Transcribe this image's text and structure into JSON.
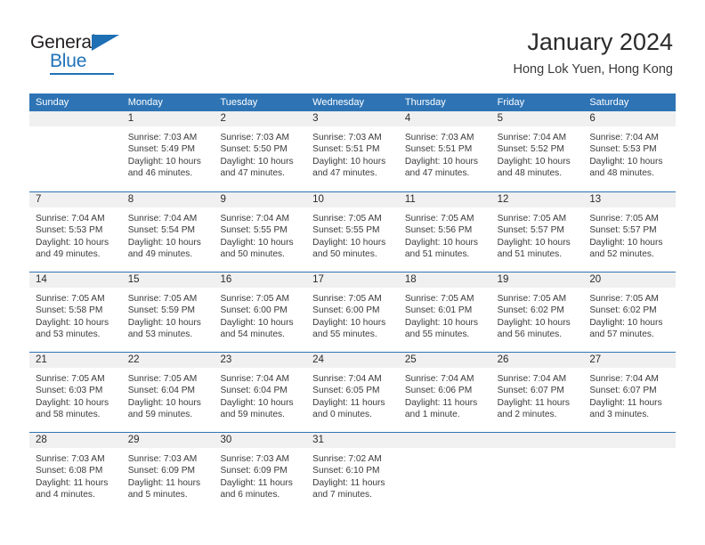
{
  "brand": {
    "name_top": "General",
    "name_bottom": "Blue",
    "accent_color": "#1f72b8",
    "text_color": "#231f20"
  },
  "header": {
    "title": "January 2024",
    "subtitle": "Hong Lok Yuen, Hong Kong"
  },
  "calendar": {
    "header_bg": "#2e74b5",
    "daynum_band_bg": "#f0f0f0",
    "weekdays": [
      "Sunday",
      "Monday",
      "Tuesday",
      "Wednesday",
      "Thursday",
      "Friday",
      "Saturday"
    ],
    "weeks": [
      [
        {
          "day": "",
          "lines": []
        },
        {
          "day": "1",
          "lines": [
            "Sunrise: 7:03 AM",
            "Sunset: 5:49 PM",
            "Daylight: 10 hours",
            "and 46 minutes."
          ]
        },
        {
          "day": "2",
          "lines": [
            "Sunrise: 7:03 AM",
            "Sunset: 5:50 PM",
            "Daylight: 10 hours",
            "and 47 minutes."
          ]
        },
        {
          "day": "3",
          "lines": [
            "Sunrise: 7:03 AM",
            "Sunset: 5:51 PM",
            "Daylight: 10 hours",
            "and 47 minutes."
          ]
        },
        {
          "day": "4",
          "lines": [
            "Sunrise: 7:03 AM",
            "Sunset: 5:51 PM",
            "Daylight: 10 hours",
            "and 47 minutes."
          ]
        },
        {
          "day": "5",
          "lines": [
            "Sunrise: 7:04 AM",
            "Sunset: 5:52 PM",
            "Daylight: 10 hours",
            "and 48 minutes."
          ]
        },
        {
          "day": "6",
          "lines": [
            "Sunrise: 7:04 AM",
            "Sunset: 5:53 PM",
            "Daylight: 10 hours",
            "and 48 minutes."
          ]
        }
      ],
      [
        {
          "day": "7",
          "lines": [
            "Sunrise: 7:04 AM",
            "Sunset: 5:53 PM",
            "Daylight: 10 hours",
            "and 49 minutes."
          ]
        },
        {
          "day": "8",
          "lines": [
            "Sunrise: 7:04 AM",
            "Sunset: 5:54 PM",
            "Daylight: 10 hours",
            "and 49 minutes."
          ]
        },
        {
          "day": "9",
          "lines": [
            "Sunrise: 7:04 AM",
            "Sunset: 5:55 PM",
            "Daylight: 10 hours",
            "and 50 minutes."
          ]
        },
        {
          "day": "10",
          "lines": [
            "Sunrise: 7:05 AM",
            "Sunset: 5:55 PM",
            "Daylight: 10 hours",
            "and 50 minutes."
          ]
        },
        {
          "day": "11",
          "lines": [
            "Sunrise: 7:05 AM",
            "Sunset: 5:56 PM",
            "Daylight: 10 hours",
            "and 51 minutes."
          ]
        },
        {
          "day": "12",
          "lines": [
            "Sunrise: 7:05 AM",
            "Sunset: 5:57 PM",
            "Daylight: 10 hours",
            "and 51 minutes."
          ]
        },
        {
          "day": "13",
          "lines": [
            "Sunrise: 7:05 AM",
            "Sunset: 5:57 PM",
            "Daylight: 10 hours",
            "and 52 minutes."
          ]
        }
      ],
      [
        {
          "day": "14",
          "lines": [
            "Sunrise: 7:05 AM",
            "Sunset: 5:58 PM",
            "Daylight: 10 hours",
            "and 53 minutes."
          ]
        },
        {
          "day": "15",
          "lines": [
            "Sunrise: 7:05 AM",
            "Sunset: 5:59 PM",
            "Daylight: 10 hours",
            "and 53 minutes."
          ]
        },
        {
          "day": "16",
          "lines": [
            "Sunrise: 7:05 AM",
            "Sunset: 6:00 PM",
            "Daylight: 10 hours",
            "and 54 minutes."
          ]
        },
        {
          "day": "17",
          "lines": [
            "Sunrise: 7:05 AM",
            "Sunset: 6:00 PM",
            "Daylight: 10 hours",
            "and 55 minutes."
          ]
        },
        {
          "day": "18",
          "lines": [
            "Sunrise: 7:05 AM",
            "Sunset: 6:01 PM",
            "Daylight: 10 hours",
            "and 55 minutes."
          ]
        },
        {
          "day": "19",
          "lines": [
            "Sunrise: 7:05 AM",
            "Sunset: 6:02 PM",
            "Daylight: 10 hours",
            "and 56 minutes."
          ]
        },
        {
          "day": "20",
          "lines": [
            "Sunrise: 7:05 AM",
            "Sunset: 6:02 PM",
            "Daylight: 10 hours",
            "and 57 minutes."
          ]
        }
      ],
      [
        {
          "day": "21",
          "lines": [
            "Sunrise: 7:05 AM",
            "Sunset: 6:03 PM",
            "Daylight: 10 hours",
            "and 58 minutes."
          ]
        },
        {
          "day": "22",
          "lines": [
            "Sunrise: 7:05 AM",
            "Sunset: 6:04 PM",
            "Daylight: 10 hours",
            "and 59 minutes."
          ]
        },
        {
          "day": "23",
          "lines": [
            "Sunrise: 7:04 AM",
            "Sunset: 6:04 PM",
            "Daylight: 10 hours",
            "and 59 minutes."
          ]
        },
        {
          "day": "24",
          "lines": [
            "Sunrise: 7:04 AM",
            "Sunset: 6:05 PM",
            "Daylight: 11 hours",
            "and 0 minutes."
          ]
        },
        {
          "day": "25",
          "lines": [
            "Sunrise: 7:04 AM",
            "Sunset: 6:06 PM",
            "Daylight: 11 hours",
            "and 1 minute."
          ]
        },
        {
          "day": "26",
          "lines": [
            "Sunrise: 7:04 AM",
            "Sunset: 6:07 PM",
            "Daylight: 11 hours",
            "and 2 minutes."
          ]
        },
        {
          "day": "27",
          "lines": [
            "Sunrise: 7:04 AM",
            "Sunset: 6:07 PM",
            "Daylight: 11 hours",
            "and 3 minutes."
          ]
        }
      ],
      [
        {
          "day": "28",
          "lines": [
            "Sunrise: 7:03 AM",
            "Sunset: 6:08 PM",
            "Daylight: 11 hours",
            "and 4 minutes."
          ]
        },
        {
          "day": "29",
          "lines": [
            "Sunrise: 7:03 AM",
            "Sunset: 6:09 PM",
            "Daylight: 11 hours",
            "and 5 minutes."
          ]
        },
        {
          "day": "30",
          "lines": [
            "Sunrise: 7:03 AM",
            "Sunset: 6:09 PM",
            "Daylight: 11 hours",
            "and 6 minutes."
          ]
        },
        {
          "day": "31",
          "lines": [
            "Sunrise: 7:02 AM",
            "Sunset: 6:10 PM",
            "Daylight: 11 hours",
            "and 7 minutes."
          ]
        },
        {
          "day": "",
          "lines": []
        },
        {
          "day": "",
          "lines": []
        },
        {
          "day": "",
          "lines": []
        }
      ]
    ]
  }
}
